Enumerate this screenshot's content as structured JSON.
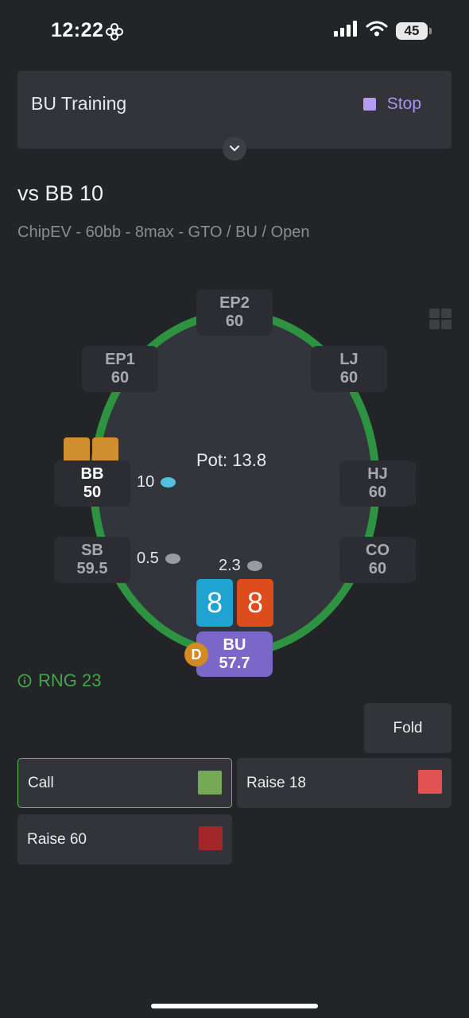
{
  "status_bar": {
    "time": "12:22",
    "battery": "45",
    "icons": [
      "flower-icon",
      "signal-icon",
      "wifi-icon",
      "battery-icon"
    ]
  },
  "training": {
    "title": "BU Training",
    "stop_label": "Stop",
    "expand_icon": "chevron-down-icon"
  },
  "spot": {
    "title": "vs BB 10",
    "subtitle": "ChipEV - 60bb - 8max - GTO / BU / Open"
  },
  "table": {
    "seats": {
      "ep2": {
        "pos": "EP2",
        "stack": "60"
      },
      "ep1": {
        "pos": "EP1",
        "stack": "60"
      },
      "lj": {
        "pos": "LJ",
        "stack": "60"
      },
      "bb": {
        "pos": "BB",
        "stack": "50"
      },
      "hj": {
        "pos": "HJ",
        "stack": "60"
      },
      "sb": {
        "pos": "SB",
        "stack": "59.5"
      },
      "co": {
        "pos": "CO",
        "stack": "60"
      },
      "bu": {
        "pos": "BU",
        "stack": "57.7"
      }
    },
    "pot": "Pot: 13.8",
    "bets": {
      "bb": "10",
      "sb": "0.5",
      "bu": "2.3"
    },
    "hero_cards": [
      "8",
      "8"
    ],
    "dealer_button": "D"
  },
  "rng": {
    "label": "RNG 23"
  },
  "actions": {
    "fold": "Fold",
    "call": "Call",
    "raise18": "Raise 18",
    "raise60": "Raise 60"
  },
  "colors": {
    "background": "#232428",
    "table_rail": "#2e9341",
    "hero_seat": "#7a67c8",
    "stop_accent": "#b59cf0",
    "card_blue": "#1fa3d1",
    "card_orange": "#de4b1d",
    "call_swatch": "#76a955",
    "raise18_swatch": "#e15252",
    "raise60_swatch": "#a3262a",
    "rng_green": "#43a64a"
  }
}
